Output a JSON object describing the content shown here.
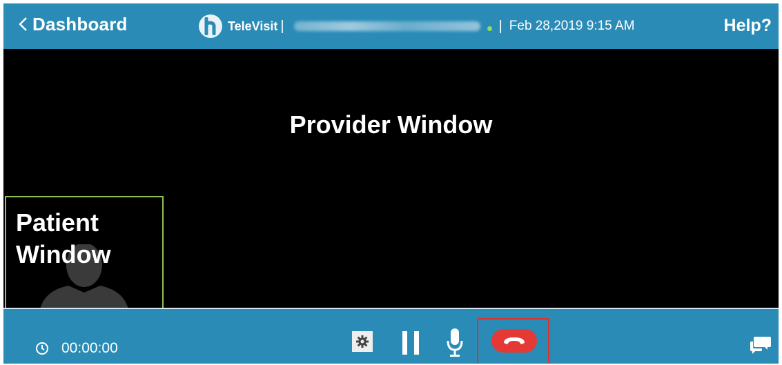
{
  "header": {
    "back_label": "Dashboard",
    "brand_name": "TeleVisit",
    "brand_separator": "|",
    "datetime_separator": "|",
    "datetime": "Feb 28,2019 9:15 AM",
    "help_label": "Help?",
    "status_color": "#8ee05a"
  },
  "provider": {
    "label": "Provider Window"
  },
  "patient": {
    "label_line1": "Patient",
    "label_line2": "Window",
    "border_color": "#8cc256"
  },
  "controls": {
    "timer": "00:00:00",
    "settings_icon": "gear-icon",
    "pause_icon": "pause-icon",
    "mic_icon": "microphone-icon",
    "end_call_icon": "phone-hangup-icon",
    "end_call_color": "#e53935",
    "chat_icon": "chat-icon"
  },
  "theme": {
    "bar_color": "#2a8bb7",
    "video_background": "#000000"
  }
}
